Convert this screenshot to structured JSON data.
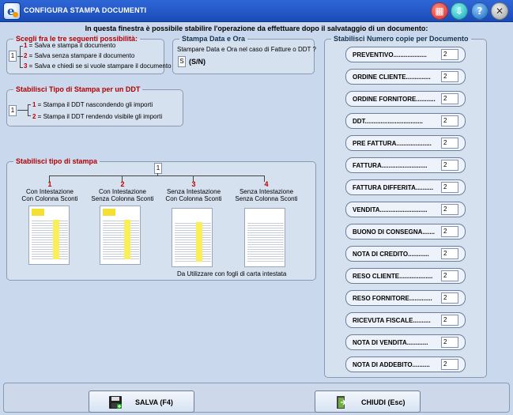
{
  "window": {
    "title": "CONFIGURA STAMPA DOCUMENTI"
  },
  "info": "In questa finestra è possibile stabilire l'operazione da effettuare dopo il salvataggio di un documento:",
  "choice": {
    "legend": "Scegli fra le tre seguenti possibilità:",
    "value": "1",
    "options": [
      {
        "num": "1",
        "text": " = Salva e stampa il documento"
      },
      {
        "num": "2",
        "text": " = Salva senza stampare il documento"
      },
      {
        "num": "3",
        "text": " = Salva e chiedi se si vuole stampare il documento"
      }
    ]
  },
  "date": {
    "legend": "Stampa Data e Ora",
    "question": "Stampare Data e Ora nel caso di Fatture o DDT ?",
    "value": "S",
    "hint": "(S/N)"
  },
  "ddt": {
    "legend": "Stabilisci Tipo di Stampa per un DDT",
    "value": "1",
    "options": [
      {
        "num": "1",
        "text": " = Stampa il DDT nascondendo  gli importi"
      },
      {
        "num": "2",
        "text": " = Stampa il DDT rendendo visibile gli importi"
      }
    ]
  },
  "print_type": {
    "legend": "Stabilisci tipo di stampa",
    "value": "1",
    "cards": [
      {
        "num": "1",
        "line1": "Con Intestazione",
        "line2": "Con Colonna Sconti"
      },
      {
        "num": "2",
        "line1": "Con Intestazione",
        "line2": "Senza Colonna Sconti"
      },
      {
        "num": "3",
        "line1": "Senza Intestazione",
        "line2": "Con Colonna Sconti"
      },
      {
        "num": "4",
        "line1": "Senza Intestazione",
        "line2": "Senza Colonna Sconti"
      }
    ],
    "footnote": "Da Utilizzare con fogli di carta intestata"
  },
  "copies": {
    "legend": "Stabilisci Numero copie per Documento",
    "items": [
      {
        "label": "PREVENTIVO...................",
        "value": "2"
      },
      {
        "label": "ORDINE CLIENTE..............",
        "value": "2"
      },
      {
        "label": "ORDINE FORNITORE...........",
        "value": "2"
      },
      {
        "label": "DDT.................................",
        "value": "2"
      },
      {
        "label": "PRE FATTURA....................",
        "value": "2"
      },
      {
        "label": "FATTURA..........................",
        "value": "2"
      },
      {
        "label": "FATTURA DIFFERITA..........",
        "value": "2"
      },
      {
        "label": "VENDITA...........................",
        "value": "2"
      },
      {
        "label": "BUONO DI CONSEGNA.......",
        "value": "2"
      },
      {
        "label": "NOTA DI CREDITO............",
        "value": "2"
      },
      {
        "label": "RESO CLIENTE...................",
        "value": "2"
      },
      {
        "label": "RESO FORNITORE.............",
        "value": "2"
      },
      {
        "label": "RICEVUTA FISCALE..........",
        "value": "2"
      },
      {
        "label": "NOTA DI VENDITA............",
        "value": "2"
      },
      {
        "label": "NOTA DI ADDEBITO..........",
        "value": "2"
      }
    ]
  },
  "footer": {
    "save_label": "SALVA (F4)",
    "close_label": "CHIUDI (Esc)"
  },
  "colors": {
    "title_bar": "#1f56c6",
    "accent_red": "#c00000",
    "window_bg": "#c9d8ec"
  }
}
